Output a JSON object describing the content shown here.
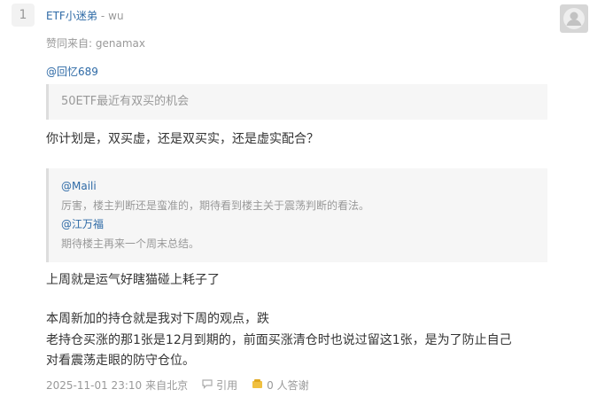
{
  "floor_number": "1",
  "author": {
    "name": "ETF小迷弟",
    "separator": "-",
    "tagline": "wu"
  },
  "source_line": "赞同来自: genamax",
  "mention_1": "@回忆689",
  "quote_1": "50ETF最近有双买的机会",
  "reply_1": "你计划是，双买虚，还是双买实，还是虚实配合？",
  "quote_2": {
    "user_1": "@Maili",
    "text_1": "厉害，楼主判断还是蛮准的，期待看到楼主关于震荡判断的看法。",
    "user_2": "@江万福",
    "text_2": "期待楼主再来一个周末总结。"
  },
  "reply_2": "上周就是运气好瞎猫碰上耗子了",
  "body_lines": [
    "本周新加的持仓就是我对下周的观点，跌",
    "老持仓买涨的那1张是12月到期的，前面买涨清仓时也说过留这1张，是为了防止自己",
    "对看震荡走眼的防守仓位。"
  ],
  "footer": {
    "datetime": "2025-11-01 23:10",
    "location": "来自北京",
    "quote_label": "引用",
    "answers_label": "0 人答谢"
  },
  "icons": [
    "comment-icon",
    "thanks-icon",
    "user-avatar-icon"
  ],
  "colors": {
    "link": "#2e6aa6",
    "muted": "#999999",
    "quote_bg": "#f6f6f6"
  }
}
